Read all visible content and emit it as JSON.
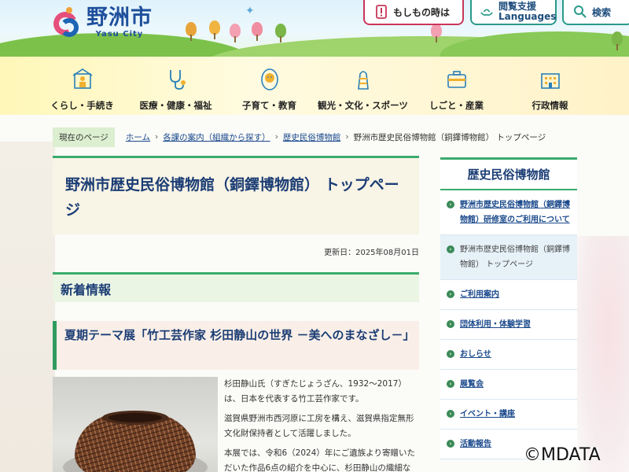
{
  "header": {
    "logo_jp": "野洲市",
    "logo_en": "Yasu City",
    "emergency_label": "もしもの時は",
    "lang_label_1": "閲覧支援",
    "lang_label_2": "Languages",
    "search_label": "検索"
  },
  "nav": {
    "items": [
      {
        "label": "くらし・手続き",
        "icon": "house-person-icon"
      },
      {
        "label": "医療・健康・福祉",
        "icon": "stethoscope-icon"
      },
      {
        "label": "子育て・教育",
        "icon": "baby-icon"
      },
      {
        "label": "観光・文化・スポーツ",
        "icon": "tower-icon"
      },
      {
        "label": "しごと・産業",
        "icon": "briefcase-icon"
      },
      {
        "label": "行政情報",
        "icon": "city-hall-icon"
      }
    ]
  },
  "breadcrumb": {
    "here": "現在のページ",
    "items": [
      "ホーム",
      "各課の案内（組織から探す）",
      "歴史民俗博物館"
    ],
    "current": "野洲市歴史民俗博物館（銅鐸博物館） トップページ"
  },
  "page": {
    "title": "野洲市歴史民俗博物館（銅鐸博物館） トップページ",
    "updated": "更新日：2025年08月01日"
  },
  "news": {
    "heading": "新着情報",
    "subheading": "夏期テーマ展「竹工芸作家 杉田静山の世界 －美へのまなざし－」",
    "paragraphs": [
      "杉田静山氏（すぎたじょうざん、1932～2017）は、日本を代表する竹工芸作家です。",
      "滋賀県野洲市西河原に工房を構え、滋賀県指定無形文化財保持者として活躍しました。",
      "本展では、令和6（2024）年にご遺族より寄贈いただいた作品6点の紹介を中心に、杉田静山の織細な"
    ]
  },
  "side": {
    "title": "歴史民俗博物館",
    "items": [
      {
        "label": "野洲市歴史民俗博物館（銅鐸博物館）研修室のご利用について",
        "current": false
      },
      {
        "label": "野洲市歴史民俗博物館（銅鐸博物館） トップページ",
        "current": true
      },
      {
        "label": "ご利用案内",
        "current": false
      },
      {
        "label": "団体利用・体験学習",
        "current": false
      },
      {
        "label": "おしらせ",
        "current": false
      },
      {
        "label": "展覧会",
        "current": false
      },
      {
        "label": "イベント・講座",
        "current": false
      },
      {
        "label": "活動報告",
        "current": false
      }
    ]
  },
  "watermark": "©MDATA",
  "colors": {
    "accent_green": "#3bac6d",
    "link_blue": "#1b4a8c",
    "title_navy": "#1b3d74"
  }
}
